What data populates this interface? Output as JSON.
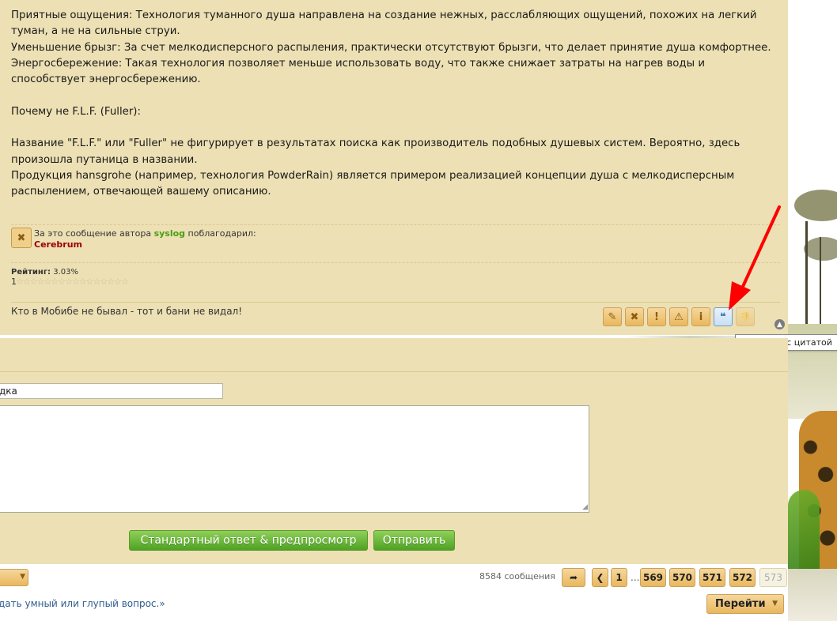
{
  "post": {
    "paragraphs": [
      "Приятные ощущения: Технология туманного душа направлена на создание нежных, расслабляющих ощущений, похожих на легкий туман, а не на сильные струи.",
      "Уменьшение брызг: За счет мелкодисперсного распыления, практически отсутствуют брызги, что делает принятие душа комфортнее.",
      "Энергосбережение: Такая технология позволяет меньше использовать воду, что также снижает затраты на нагрев воды и способствует энергосбережению.",
      "",
      "Почему не F.L.F. (Fuller):",
      "",
      "Название \"F.L.F.\" или \"Fuller\" не фигурирует в результатах поиска как производитель подобных душевых систем. Вероятно, здесь произошла путаница в названии.",
      "Продукция hansgrohe (например, технология PowderRain) является примером реализацией концепции душа с мелкодисперсным распылением, отвечающей вашему описанию."
    ],
    "thanks": {
      "prefix": "За это сообщение автора",
      "author": "syslog",
      "suffix": "поблагодарил:",
      "user": "Cerebrum"
    },
    "rating": {
      "label": "Рейтинг:",
      "value": "3.03%",
      "count": "1",
      "stars": "☆☆☆☆☆☆☆☆☆☆☆☆☆☆☆☆"
    },
    "signature": "Кто в Мобибе не бывал - тот и бани не видал!",
    "actions": [
      {
        "icon": "pencil-icon",
        "glyph": "✎"
      },
      {
        "icon": "delete-icon",
        "glyph": "✖"
      },
      {
        "icon": "exclamation-icon",
        "glyph": "!"
      },
      {
        "icon": "warning-icon",
        "glyph": "⚠"
      },
      {
        "icon": "info-icon",
        "glyph": "i"
      },
      {
        "icon": "quote-icon",
        "glyph": "❝"
      },
      {
        "icon": "thumbs-down-icon",
        "glyph": "👎"
      }
    ],
    "up_icon": "▲"
  },
  "tooltip": "Ответить с цитатой",
  "form": {
    "subject_value": "дка",
    "preview_button": "Стандартный ответ & предпросмотр",
    "send_button": "Отправить"
  },
  "pagination": {
    "post_count": "8584 сообщения",
    "pages": [
      "1",
      "569",
      "570",
      "571",
      "572",
      "573"
    ],
    "current_page": "573",
    "ellipsis": "...",
    "prev_glyph": "❮",
    "jump_glyph": "➦"
  },
  "footer": {
    "quote_link": "дать умный или глупый вопрос.»",
    "goto_button": "Перейти"
  },
  "colors": {
    "panel_bg": "#ede0b4",
    "accent_green": "#4ea123",
    "author_green": "#4a9e12",
    "user_red": "#9b0000",
    "arrow_red": "#ff0000"
  }
}
